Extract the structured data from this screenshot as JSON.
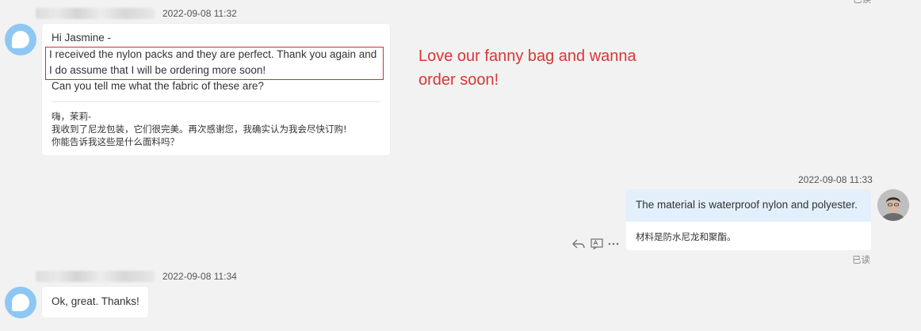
{
  "top_corner_status": "已读",
  "messages": [
    {
      "timestamp": "2022-09-08 11:32",
      "lines": [
        "Hi Jasmine -",
        "I received the nylon packs and they are perfect. Thank you again and",
        "I do assume that I will be ordering more soon!",
        "Can you tell me what the fabric of these are?"
      ],
      "translation": [
        "嗨，茉莉-",
        "我收到了尼龙包装，它们很完美。再次感谢您，我确实认为我会尽快订购!",
        "你能告诉我这些是什么面料吗？"
      ]
    },
    {
      "timestamp": "2022-09-08 11:33",
      "text": "The material is waterproof nylon and polyester.",
      "translation": "材料是防水尼龙和聚酯。",
      "read_status": "已读"
    },
    {
      "timestamp": "2022-09-08 11:34",
      "text": "Ok, great. Thanks!"
    }
  ],
  "annotation": {
    "line1": "Love our fanny bag and wanna",
    "line2": "order soon!",
    "color": "#d93636"
  },
  "colors": {
    "background": "#f2f2f2",
    "outgoing_bubble": "#e3f0fc",
    "bot_avatar": "#8ec7f2",
    "highlight": "#c9323a"
  },
  "icons": {
    "reply": "reply-icon",
    "translate": "translate-icon",
    "more": "more-icon"
  }
}
